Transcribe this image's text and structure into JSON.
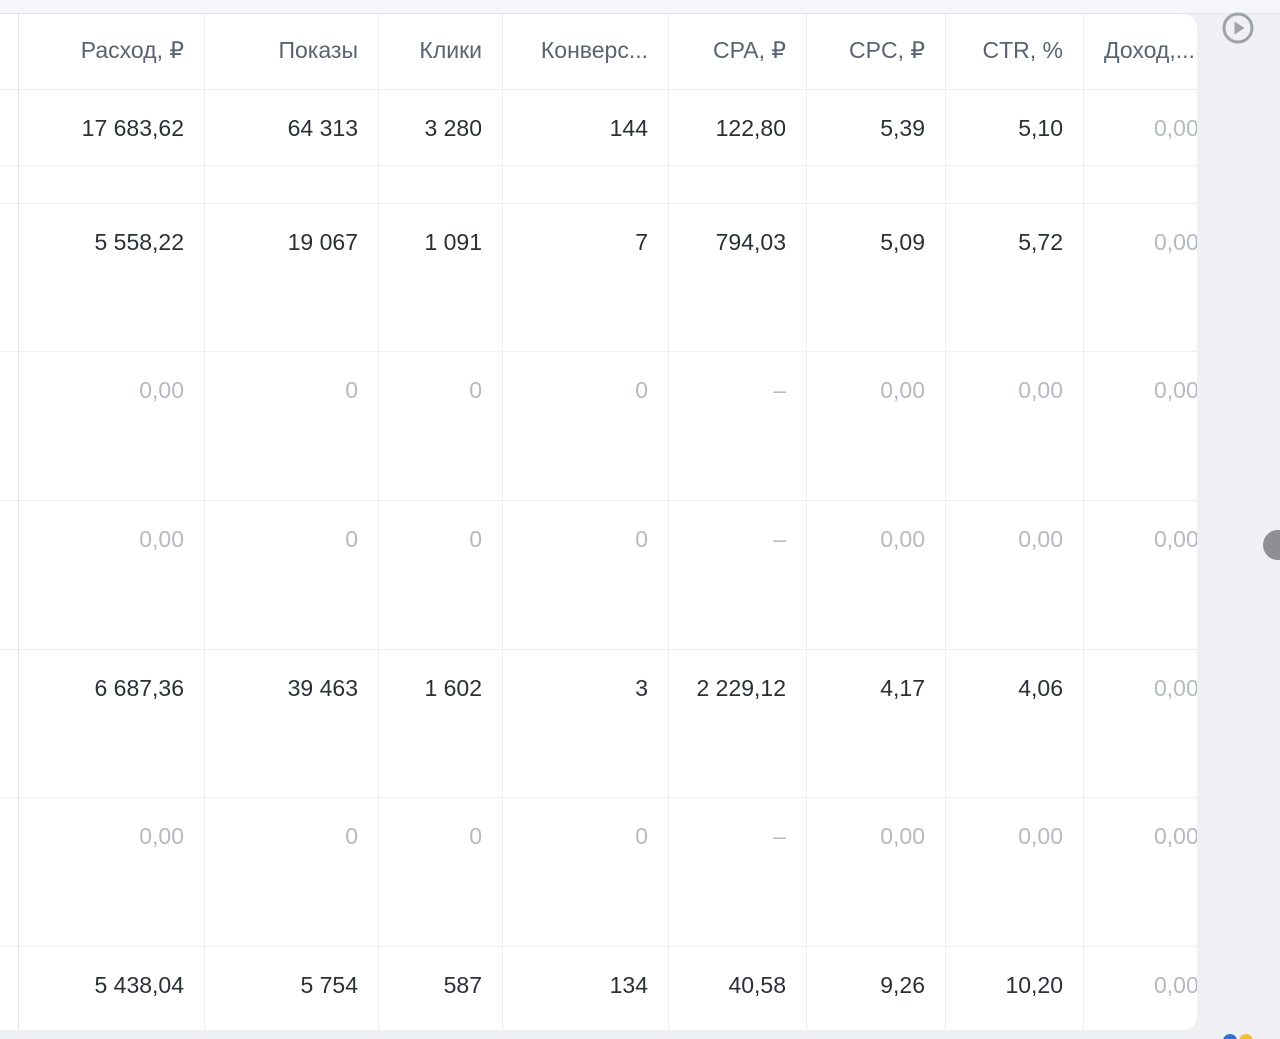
{
  "table": {
    "columns": [
      "Расход, ₽",
      "Показы",
      "Клики",
      "Конверс...",
      "CPA, ₽",
      "CPC, ₽",
      "CTR, %",
      "Доход,..."
    ],
    "rows": [
      [
        "17 683,62",
        "64 313",
        "3 280",
        "144",
        "122,80",
        "5,39",
        "5,10",
        "0,00"
      ],
      [
        "",
        "",
        "",
        "",
        "",
        "",
        "",
        ""
      ],
      [
        "5 558,22",
        "19 067",
        "1 091",
        "7",
        "794,03",
        "5,09",
        "5,72",
        "0,00"
      ],
      [
        "0,00",
        "0",
        "0",
        "0",
        "–",
        "0,00",
        "0,00",
        "0,00"
      ],
      [
        "0,00",
        "0",
        "0",
        "0",
        "–",
        "0,00",
        "0,00",
        "0,00"
      ],
      [
        "6 687,36",
        "39 463",
        "1 602",
        "3",
        "2 229,12",
        "4,17",
        "4,06",
        "0,00"
      ],
      [
        "0,00",
        "0",
        "0",
        "0",
        "–",
        "0,00",
        "0,00",
        "0,00"
      ],
      [
        "5 438,04",
        "5 754",
        "587",
        "134",
        "40,58",
        "9,26",
        "10,20",
        "0,00"
      ]
    ],
    "muted_rows": [
      3,
      4,
      6
    ]
  },
  "icons": {
    "play": "play-circle-icon",
    "scroll": "side-scroll-handle"
  },
  "colors": {
    "text": "#2b2f36",
    "muted_text": "#b5b9c0",
    "header_text": "#5c6370",
    "grid": "#eceef1",
    "background": "#eef0f3"
  }
}
